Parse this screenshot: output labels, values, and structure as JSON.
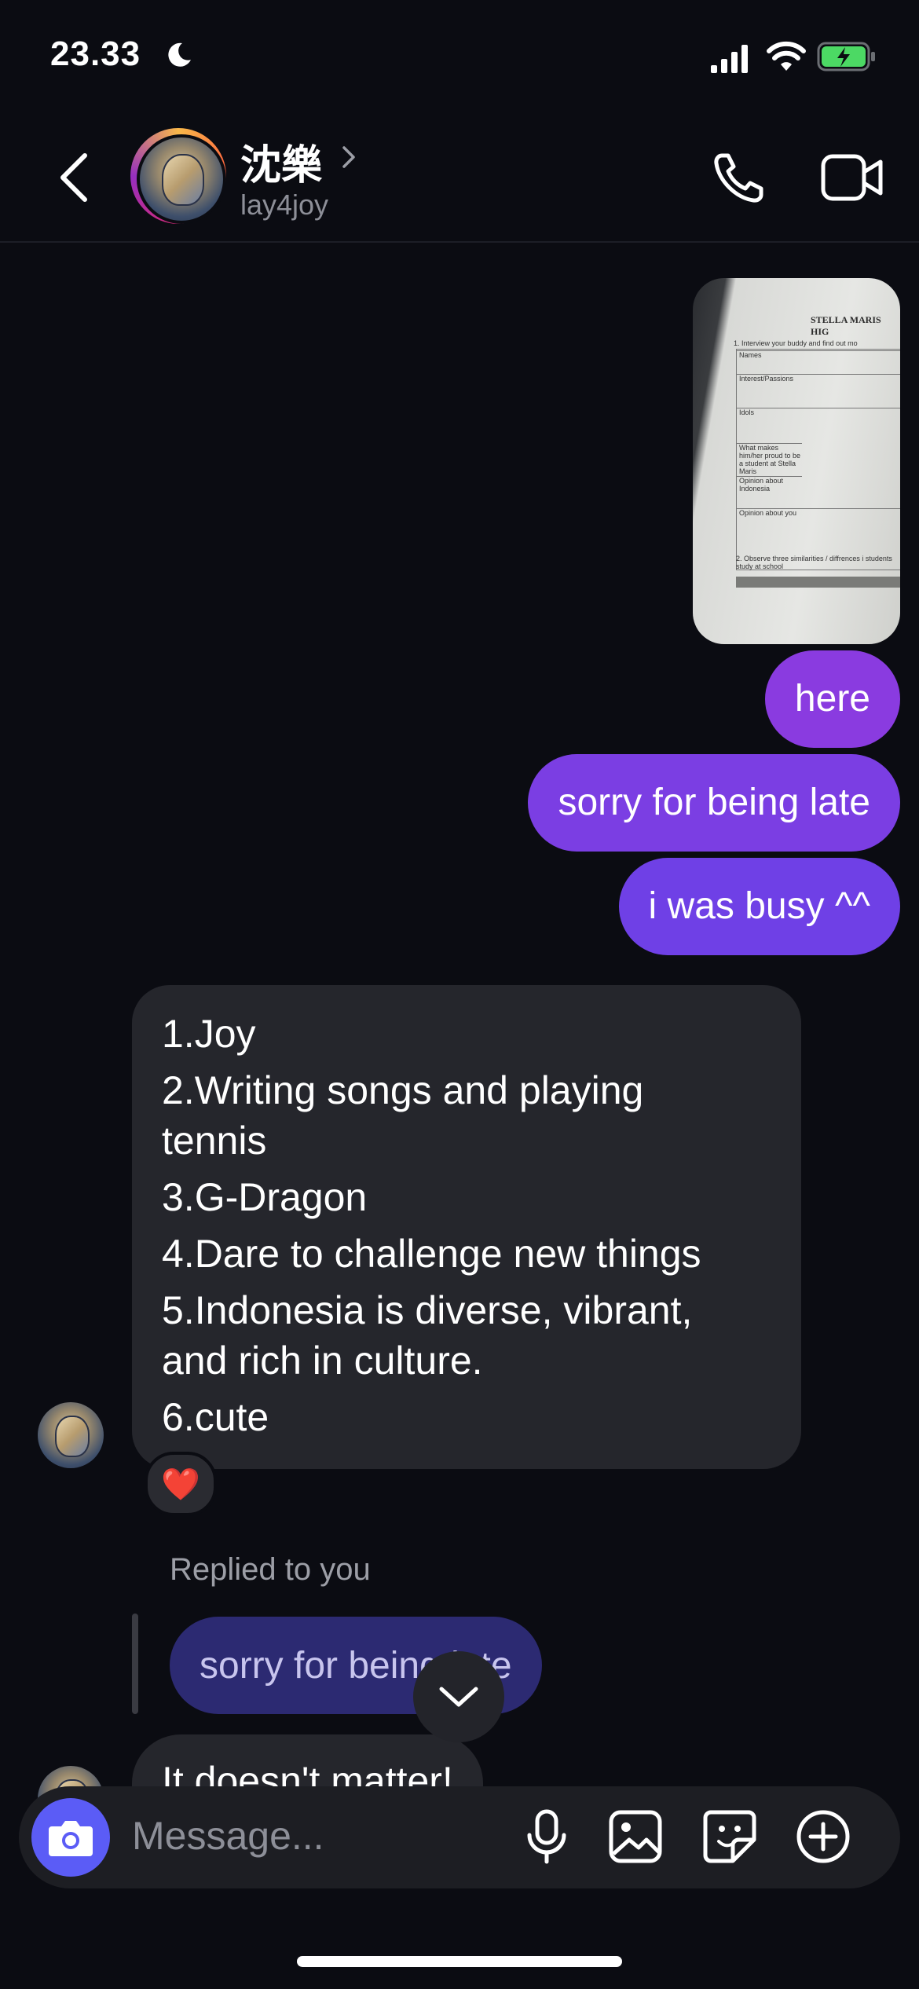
{
  "status_bar": {
    "time": "23.33"
  },
  "header": {
    "display_name": "沈樂",
    "username": "lay4joy"
  },
  "photo": {
    "title": "STELLA MARIS HIG",
    "prompt1": "1. Interview your buddy and find out mo",
    "rows": [
      "Names",
      "Interest/Passions",
      "Idols",
      "What makes him/her proud to be a student at Stella Maris",
      "Opinion about Indonesia",
      "Opinion about you"
    ],
    "prompt2": "2. Observe three similarities / diffrences i students study at school"
  },
  "sent_messages": [
    "here",
    "sorry for being late",
    "i was busy ^^"
  ],
  "received_message": {
    "lines": [
      "1.Joy",
      "2.Writing songs and playing",
      "tennis",
      "3.G-Dragon",
      "4.Dare to challenge new things",
      "5.Indonesia is diverse, vibrant,",
      "and rich in culture.",
      "6.cute"
    ],
    "reaction": "❤️"
  },
  "reply": {
    "label": "Replied to you",
    "quoted": "sorry for being late",
    "text": "It doesn't matter!"
  },
  "composer": {
    "placeholder": "Message..."
  },
  "colors": {
    "accent": "#5b5cf6",
    "sent_bubble": "#7b3ee3",
    "received_bubble": "#25262c",
    "background": "#0b0c12"
  }
}
